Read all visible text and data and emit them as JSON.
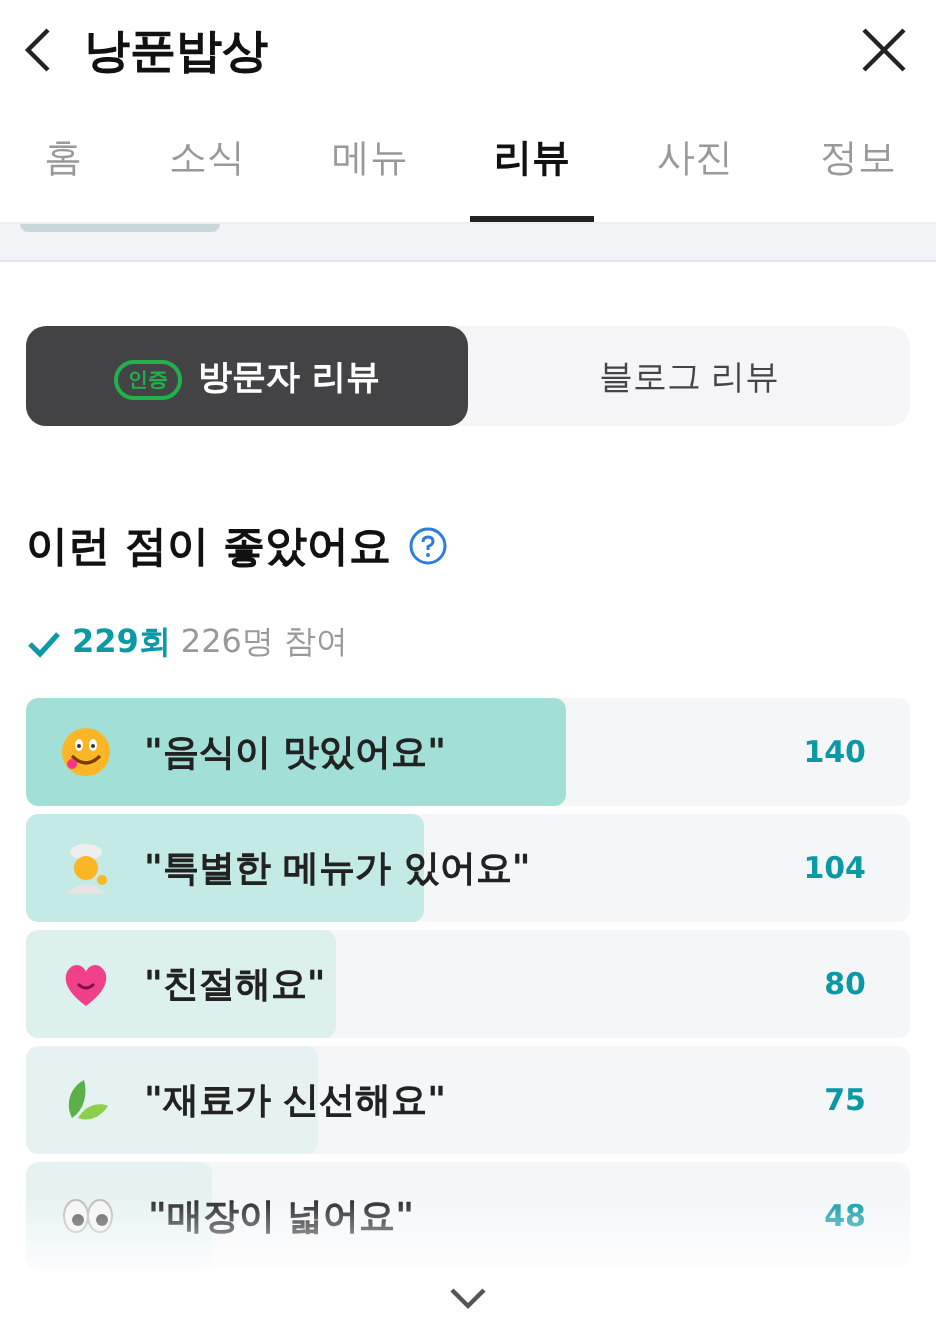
{
  "header": {
    "title": "낭푼밥상"
  },
  "tabs": [
    {
      "label": "홈",
      "selected": false
    },
    {
      "label": "소식",
      "selected": false
    },
    {
      "label": "메뉴",
      "selected": false
    },
    {
      "label": "리뷰",
      "selected": true
    },
    {
      "label": "사진",
      "selected": false
    },
    {
      "label": "정보",
      "selected": false
    }
  ],
  "review_toggle": [
    {
      "label": "방문자 리뷰",
      "badge": "인증",
      "selected": true
    },
    {
      "label": "블로그 리뷰",
      "selected": false
    }
  ],
  "section": {
    "title": "이런 점이 좋았어요",
    "count": "229회",
    "participants": "226명 참여"
  },
  "keywords": [
    {
      "label": "\"음식이 맛있어요\"",
      "count": "140",
      "level": 0.61,
      "color": "#a1dfd7",
      "faded": false
    },
    {
      "label": "\"특별한 메뉴가 있어요\"",
      "count": "104",
      "level": 0.45,
      "color": "#c3eae5",
      "faded": false
    },
    {
      "label": "\"친절해요\"",
      "count": "80",
      "level": 0.35,
      "color": "#dcf0ee",
      "faded": false
    },
    {
      "label": "\"재료가 신선해요\"",
      "count": "75",
      "level": 0.33,
      "color": "#e6f2f2",
      "faded": false
    },
    {
      "label": "\"매장이 넓어요\"",
      "count": "48",
      "level": 0.21,
      "color": "#e6f2f2",
      "faded": true
    }
  ]
}
